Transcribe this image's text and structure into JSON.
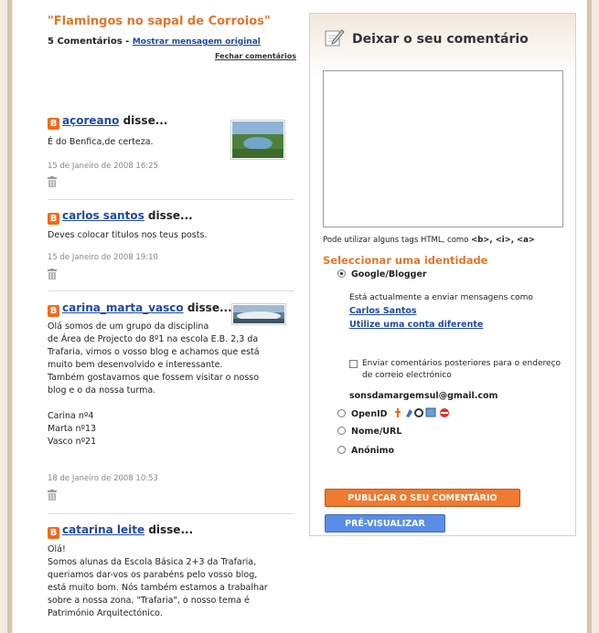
{
  "post": {
    "title": "\"Flamingos no sapal de Corroios\"",
    "comment_count": "5 Comentários",
    "dash": " - ",
    "show_original": "Mostrar mensagem original",
    "close_comments": "Fechar comentários"
  },
  "said": " disse...",
  "comments": [
    {
      "author": "açoreano",
      "text": "É do Benfica,de certeza.",
      "date": "15 de Janeiro de 2008 16:25"
    },
    {
      "author": "carlos santos",
      "text": "Deves colocar titulos nos teus posts.",
      "date": "15 de Janeiro de 2008 19:10"
    },
    {
      "author": "carina_marta_vasco",
      "text": "Olá somos de um grupo da disciplina\nde Área de Projecto do 8º1 na escola E.B. 2,3 da\nTrafaria, vimos o vosso blog e achamos que está\nmuito bem desenvolvido e interessante.\nTambém gostavamos que fossem visitar o nosso\nblog e o da nossa turma.\n\nCarina nº4\nMarta nº13\nVasco nº21",
      "date": "18 de Janeiro de 2008 10:53"
    },
    {
      "author": "catarina leite",
      "text": "Olá!\nSomos alunas da Escola Básica 2+3 da Trafaria,\nqueriamos dar-vos os parabéns pelo vosso blog,\nestá muito bom. Nós também estamos a trabalhar\nsobre a nossa zona, \"Trafaria\", o nosso tema é\nPatrimónio Arquitectónico."
    }
  ],
  "form": {
    "title": "Deixar o seu comentário",
    "comment_value": "",
    "html_note_prefix": "Pode utilizar alguns tags HTML, como ",
    "html_tags": "<b>, <i>, <a>",
    "identity_title": "Seleccionar uma identidade",
    "options": {
      "google": "Google/Blogger",
      "openid": "OpenID",
      "nameurl": "Nome/URL",
      "anon": "Anónimo"
    },
    "signed_in_text": "Está actualmente a enviar mensagens como",
    "user_name": "Carlos Santos",
    "other_account": "Utilize uma conta diferente",
    "follow_up_label": "Enviar comentários posteriores para o endereço de correio electrónico",
    "email": "sonsdamargemsul@gmail.com",
    "publish_button": "PUBLICAR O SEU COMENTÁRIO",
    "preview_button": "PRÉ-VISUALIZAR"
  },
  "colors": {
    "accent_orange": "#e0762a",
    "link_blue": "#1f4aa0",
    "publish_bg": "#f07a2f",
    "preview_bg": "#5a8ee6"
  }
}
